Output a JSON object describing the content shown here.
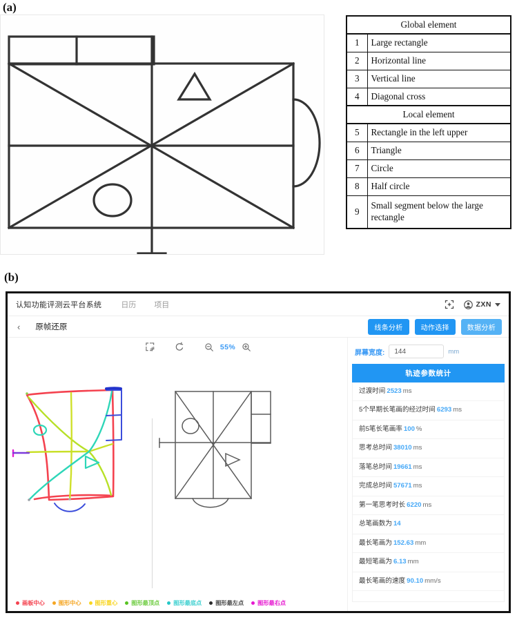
{
  "figure": {
    "label_a": "(a)",
    "label_b": "(b)"
  },
  "rey_table": {
    "section_global": "Global element",
    "section_local": "Local element",
    "rows": [
      {
        "num": "1",
        "label": "Large rectangle"
      },
      {
        "num": "2",
        "label": "Horizontal line"
      },
      {
        "num": "3",
        "label": "Vertical line"
      },
      {
        "num": "4",
        "label": "Diagonal cross"
      },
      {
        "num": "5",
        "label": "Rectangle in the left upper"
      },
      {
        "num": "6",
        "label": "Triangle"
      },
      {
        "num": "7",
        "label": "Circle"
      },
      {
        "num": "8",
        "label": "Half circle"
      },
      {
        "num": "9",
        "label": "Small segment below the large rectangle"
      }
    ]
  },
  "app": {
    "title": "认知功能评测云平台系统",
    "nav": [
      {
        "label": "日历",
        "name": "nav-calendar"
      },
      {
        "label": "项目",
        "name": "项目"
      }
    ],
    "fullscreen_icon": "fullscreen-icon",
    "user": {
      "avatar_icon": "user-avatar-icon",
      "name": "ZXN",
      "caret_icon": "chevron-down-icon"
    },
    "sub_bar": {
      "back_icon": "back-chevron-icon",
      "back_glyph": "‹",
      "page_title": "原帧还原",
      "buttons": [
        {
          "label": "线条分析",
          "name": "line-analysis-button"
        },
        {
          "label": "动作选择",
          "name": "action-select-button"
        },
        {
          "label": "数据分析",
          "name": "data-analysis-button"
        }
      ]
    },
    "toolbar": {
      "crop_icon": "crop-select-icon",
      "reset_icon": "reset-rotate-icon",
      "zoom_out_icon": "zoom-out-icon",
      "zoom_level": "55%",
      "zoom_in_icon": "zoom-in-icon"
    },
    "legend": [
      {
        "label": "画板中心",
        "color": "#f4424f"
      },
      {
        "label": "图形中心",
        "color": "#f5a623"
      },
      {
        "label": "图形重心",
        "color": "#f8d521"
      },
      {
        "label": "图形最顶点",
        "color": "#58c322"
      },
      {
        "label": "图形最底点",
        "color": "#25c7c7"
      },
      {
        "label": "图形最左点",
        "color": "#2b2b2b"
      },
      {
        "label": "图形最右点",
        "color": "#e61ad0"
      }
    ],
    "data_panel": {
      "screen_width_label": "屏幕宽度:",
      "screen_width_value": "144",
      "screen_width_placeholder": "144",
      "screen_width_unit": "mm",
      "stats_header": "轨迹参数统计",
      "stats": [
        {
          "label": "过渡时间",
          "value": "2523",
          "unit": "ms"
        },
        {
          "label": "5个早期长笔画的经过时间",
          "value": "6293",
          "unit": "ms"
        },
        {
          "label": "前5笔长笔画率",
          "value": "100",
          "unit": "%"
        },
        {
          "label": "思考总时间",
          "value": "38010",
          "unit": "ms"
        },
        {
          "label": "落笔总时间",
          "value": "19661",
          "unit": "ms"
        },
        {
          "label": "完成总时间",
          "value": "57671",
          "unit": "ms"
        },
        {
          "label": "第一笔思考时长",
          "value": "6220",
          "unit": "ms"
        },
        {
          "label": "总笔画数为",
          "value": "14",
          "unit": ""
        },
        {
          "label": "最长笔画为",
          "value": "152.63",
          "unit": "mm"
        },
        {
          "label": "最短笔画为",
          "value": "6.13",
          "unit": "mm"
        },
        {
          "label": "最长笔画的速度",
          "value": "90.10",
          "unit": "mm/s"
        }
      ]
    }
  },
  "colors": {
    "accent_blue": "#2196f3",
    "value_blue": "#45a8f7",
    "light_blue_btn": "#55b2f5"
  }
}
